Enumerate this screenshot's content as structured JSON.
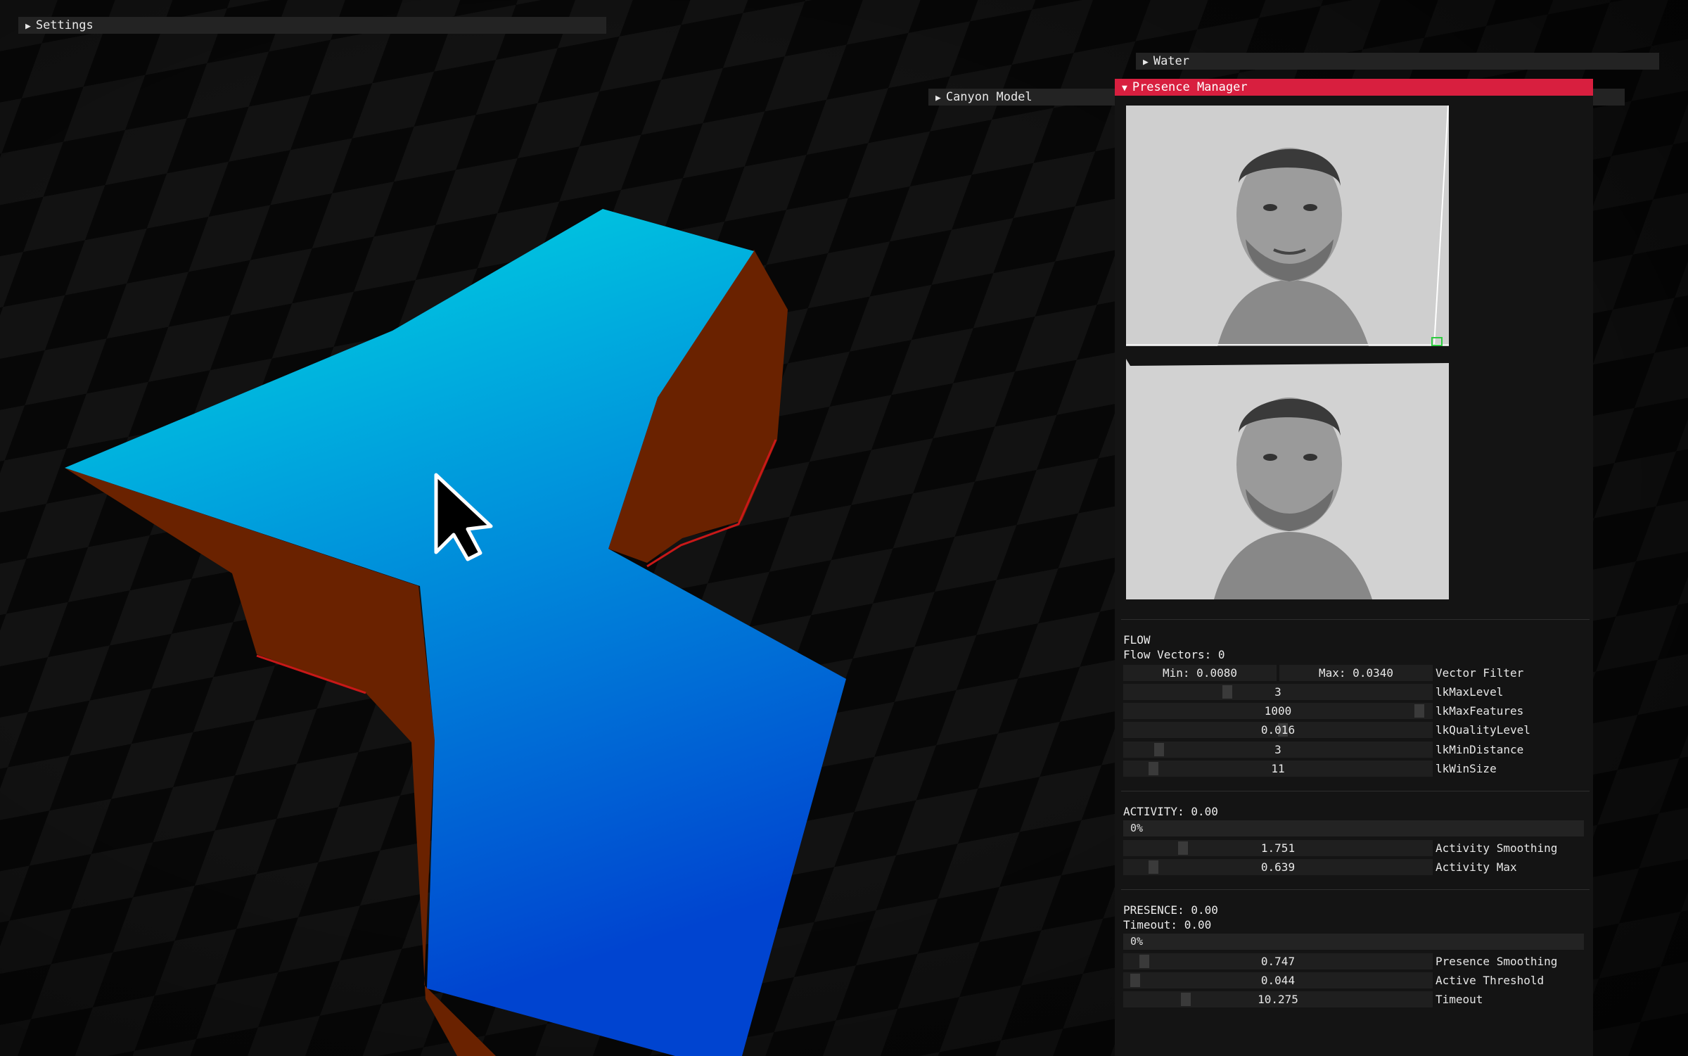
{
  "windows": {
    "settings": {
      "label": "Settings",
      "arrow": "▶"
    },
    "water": {
      "label": "Water",
      "arrow": "▶"
    },
    "canyon": {
      "label": "Canyon Model",
      "arrow": "▶"
    },
    "presence": {
      "label": "Presence Manager",
      "arrow": "▼"
    }
  },
  "flow": {
    "heading": "FLOW",
    "vectors": "Flow Vectors: 0",
    "filter_min": "Min: 0.0080",
    "filter_max": "Max: 0.0340",
    "filter_label": "Vector Filter",
    "sliders": [
      {
        "value": "3",
        "label": "lkMaxLevel",
        "level": 0.33
      },
      {
        "value": "1000",
        "label": "lkMaxFeatures",
        "level": 0.98
      },
      {
        "value": "0.016",
        "label": "lkQualityLevel",
        "level": 0.52
      },
      {
        "value": "3",
        "label": "lkMinDistance",
        "level": 0.1
      },
      {
        "value": "11",
        "label": "lkWinSize",
        "level": 0.08
      }
    ]
  },
  "activity": {
    "heading": "ACTIVITY: 0.00",
    "progress_text": "0%",
    "progress": 0,
    "sliders": [
      {
        "value": "1.751",
        "label": "Activity Smoothing",
        "level": 0.18
      },
      {
        "value": "0.639",
        "label": "Activity Max",
        "level": 0.08
      }
    ]
  },
  "presence": {
    "heading": "PRESENCE: 0.00",
    "timeout_text": "Timeout: 0.00",
    "progress_text": "0%",
    "progress": 0,
    "sliders": [
      {
        "value": "0.747",
        "label": "Presence Smoothing",
        "level": 0.05
      },
      {
        "value": "0.044",
        "label": "Active Threshold",
        "level": 0.02
      },
      {
        "value": "10.275",
        "label": "Timeout",
        "level": 0.19
      }
    ]
  },
  "colors": {
    "accent": "#d81f3f",
    "water_top": "#00d8e0",
    "water_bottom": "#0048d0",
    "canyon_wall": "#6a2200"
  },
  "icons": {
    "cursor": "mouse-pointer-icon"
  }
}
